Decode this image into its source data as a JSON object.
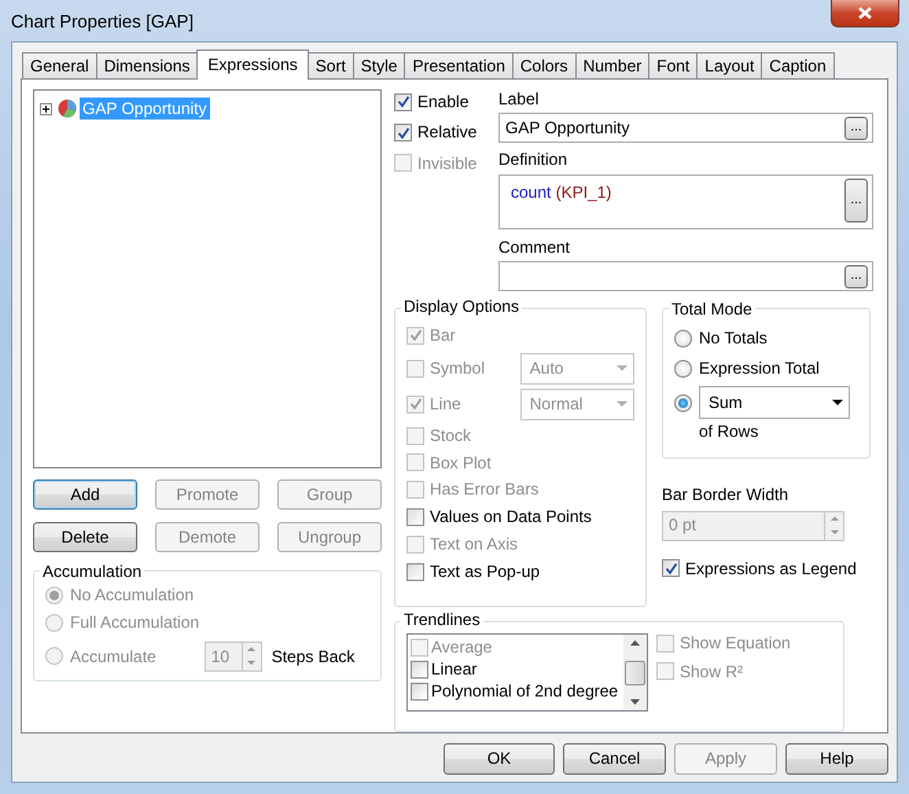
{
  "window": {
    "title": "Chart Properties [GAP]"
  },
  "tabs": [
    {
      "label": "General",
      "selected": false
    },
    {
      "label": "Dimensions",
      "selected": false
    },
    {
      "label": "Expressions",
      "selected": true
    },
    {
      "label": "Sort",
      "selected": false
    },
    {
      "label": "Style",
      "selected": false
    },
    {
      "label": "Presentation",
      "selected": false
    },
    {
      "label": "Colors",
      "selected": false
    },
    {
      "label": "Number",
      "selected": false
    },
    {
      "label": "Font",
      "selected": false
    },
    {
      "label": "Layout",
      "selected": false
    },
    {
      "label": "Caption",
      "selected": false
    }
  ],
  "expressions_tree": {
    "items": [
      {
        "label": "GAP Opportunity",
        "selected": true,
        "expanded": false
      }
    ]
  },
  "expression_buttons": [
    {
      "label": "Add",
      "disabled": false,
      "default": true
    },
    {
      "label": "Promote",
      "disabled": true,
      "default": false
    },
    {
      "label": "Group",
      "disabled": true,
      "default": false
    },
    {
      "label": "Delete",
      "disabled": false,
      "default": false
    },
    {
      "label": "Demote",
      "disabled": true,
      "default": false
    },
    {
      "label": "Ungroup",
      "disabled": true,
      "default": false
    }
  ],
  "accumulation": {
    "title": "Accumulation",
    "options": [
      {
        "label": "No Accumulation",
        "selected": true,
        "disabled": true
      },
      {
        "label": "Full Accumulation",
        "selected": false,
        "disabled": true
      },
      {
        "label": "Accumulate",
        "selected": false,
        "disabled": true,
        "steps": {
          "value": "10",
          "label": "Steps Back"
        }
      }
    ]
  },
  "flags": [
    {
      "label": "Enable",
      "checked": true,
      "disabled": false
    },
    {
      "label": "Relative",
      "checked": true,
      "disabled": false
    },
    {
      "label": "Invisible",
      "checked": false,
      "disabled": true
    }
  ],
  "label_field": {
    "label": "Label",
    "value": "GAP Opportunity",
    "button": "..."
  },
  "definition_field": {
    "label": "Definition",
    "button": "...",
    "tokens": [
      {
        "text": "count ",
        "kind": "function"
      },
      {
        "text": "(KPI_1)",
        "kind": "field"
      }
    ]
  },
  "comment_field": {
    "label": "Comment",
    "button": "..."
  },
  "display_options": {
    "title": "Display Options",
    "items": [
      {
        "label": "Bar",
        "checked": true,
        "disabled": true
      },
      {
        "label": "Symbol",
        "checked": false,
        "disabled": true,
        "dropdown": {
          "value": "Auto",
          "disabled": true
        }
      },
      {
        "label": "Line",
        "checked": true,
        "disabled": true,
        "dropdown": {
          "value": "Normal",
          "disabled": true
        }
      },
      {
        "label": "Stock",
        "checked": false,
        "disabled": true
      },
      {
        "label": "Box Plot",
        "checked": false,
        "disabled": true
      },
      {
        "label": "Has Error Bars",
        "checked": false,
        "disabled": true
      },
      {
        "label": "Values on Data Points",
        "checked": false,
        "disabled": false
      },
      {
        "label": "Text on Axis",
        "checked": false,
        "disabled": true
      },
      {
        "label": "Text as Pop-up",
        "checked": false,
        "disabled": false
      }
    ]
  },
  "total_mode": {
    "title": "Total Mode",
    "options": [
      {
        "label": "No Totals",
        "selected": false
      },
      {
        "label": "Expression Total",
        "selected": false
      },
      {
        "selected": true,
        "dropdown": {
          "value": "Sum"
        },
        "suffix": "of Rows"
      }
    ]
  },
  "bar_border_width": {
    "label": "Bar Border Width",
    "value": "0 pt",
    "disabled": true
  },
  "expressions_as_legend": {
    "label": "Expressions as Legend",
    "checked": true,
    "disabled": false
  },
  "trendlines": {
    "title": "Trendlines",
    "items": [
      {
        "label": "Average",
        "checked": false,
        "disabled": true
      },
      {
        "label": "Linear",
        "checked": false,
        "disabled": false
      },
      {
        "label": "Polynomial of 2nd degree",
        "checked": false,
        "disabled": false
      }
    ],
    "options": [
      {
        "label": "Show Equation",
        "checked": false,
        "disabled": true
      },
      {
        "label": "Show R²",
        "checked": false,
        "disabled": true
      }
    ]
  },
  "dialog_buttons": [
    {
      "label": "OK",
      "disabled": false
    },
    {
      "label": "Cancel",
      "disabled": false
    },
    {
      "label": "Apply",
      "disabled": true
    },
    {
      "label": "Help",
      "disabled": false
    }
  ]
}
